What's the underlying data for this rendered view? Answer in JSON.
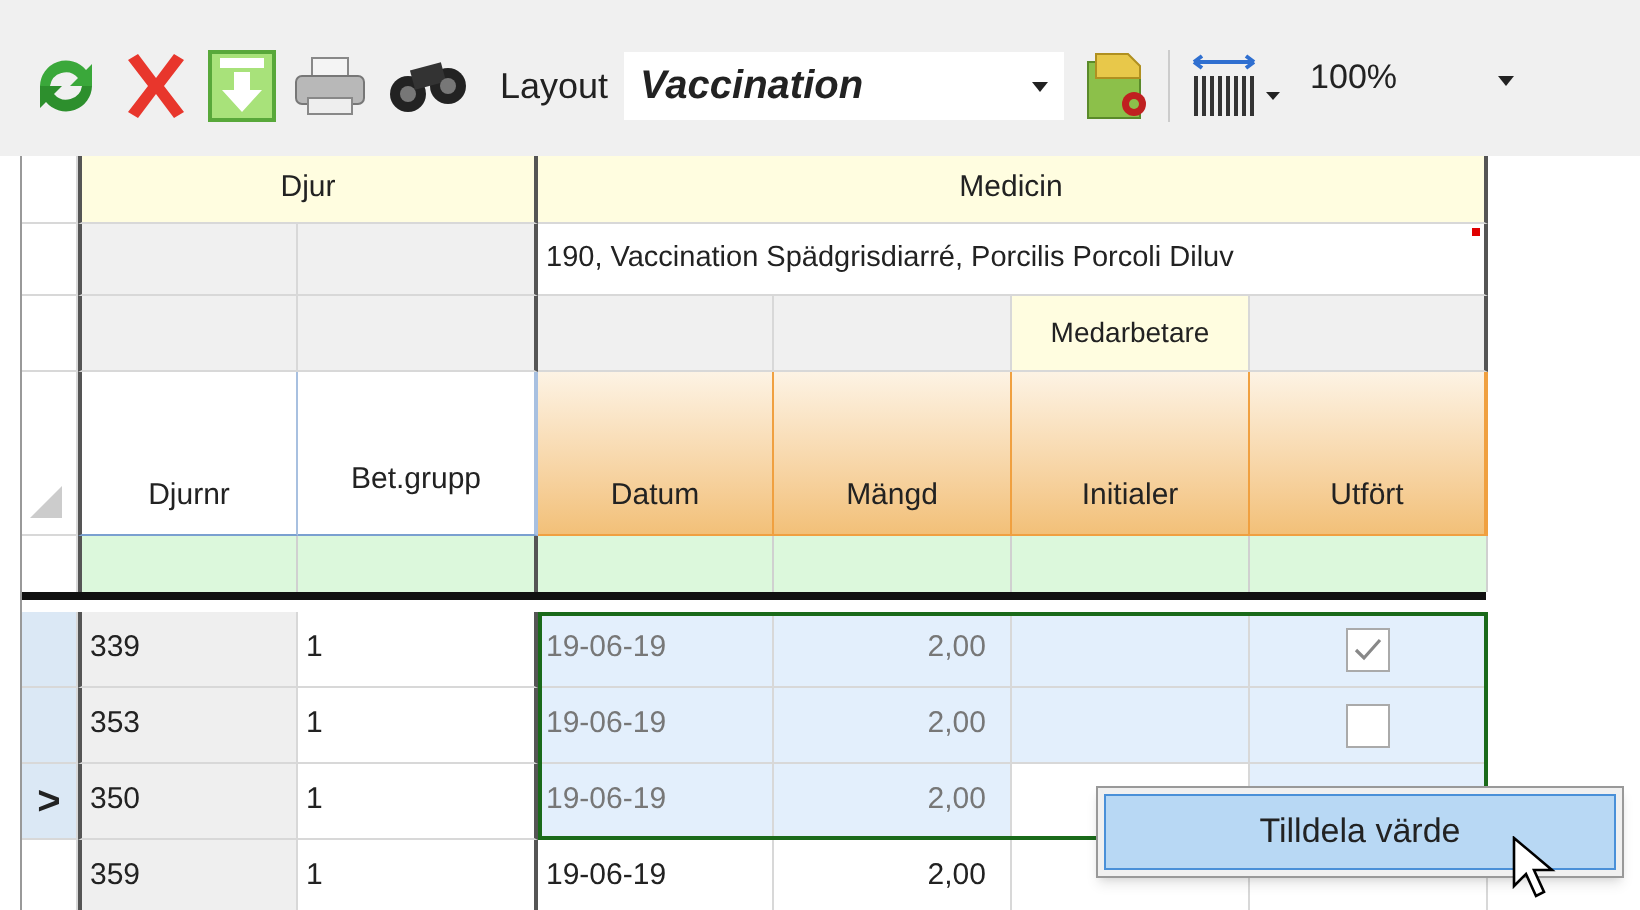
{
  "toolbar": {
    "buttons": [
      {
        "kind": "refresh"
      },
      {
        "kind": "delete"
      },
      {
        "kind": "download"
      },
      {
        "kind": "print"
      },
      {
        "kind": "find"
      }
    ],
    "layout_label": "Layout",
    "layout_value": "Vaccination",
    "zoom_value": "100%"
  },
  "grid": {
    "groups": [
      {
        "label": "Djur"
      },
      {
        "label": "Medicin"
      }
    ],
    "medicine_name": "190, Vaccination Spädgrisdiarré, Porcilis Porcoli Diluv",
    "subgroup": "Medarbetare",
    "columns": [
      "Djurnr",
      "Bet.grupp",
      "Datum",
      "Mängd",
      "Initialer",
      "Utfört"
    ],
    "current_marker": ">",
    "rows": [
      {
        "djurnr": "339",
        "bet_grupp": "1",
        "datum": "19-06-19",
        "mangd": "2,00",
        "checked": true,
        "selected": true,
        "current": false
      },
      {
        "djurnr": "353",
        "bet_grupp": "1",
        "datum": "19-06-19",
        "mangd": "2,00",
        "checked": false,
        "selected": true,
        "current": false
      },
      {
        "djurnr": "350",
        "bet_grupp": "1",
        "datum": "19-06-19",
        "mangd": "2,00",
        "selected": true,
        "current": true
      },
      {
        "djurnr": "359",
        "bet_grupp": "1",
        "datum": "19-06-19",
        "mangd": "2,00",
        "selected": false,
        "current": false
      }
    ]
  },
  "context_menu": {
    "items": [
      {
        "label": "Tilldela värde",
        "selected": true
      }
    ]
  }
}
